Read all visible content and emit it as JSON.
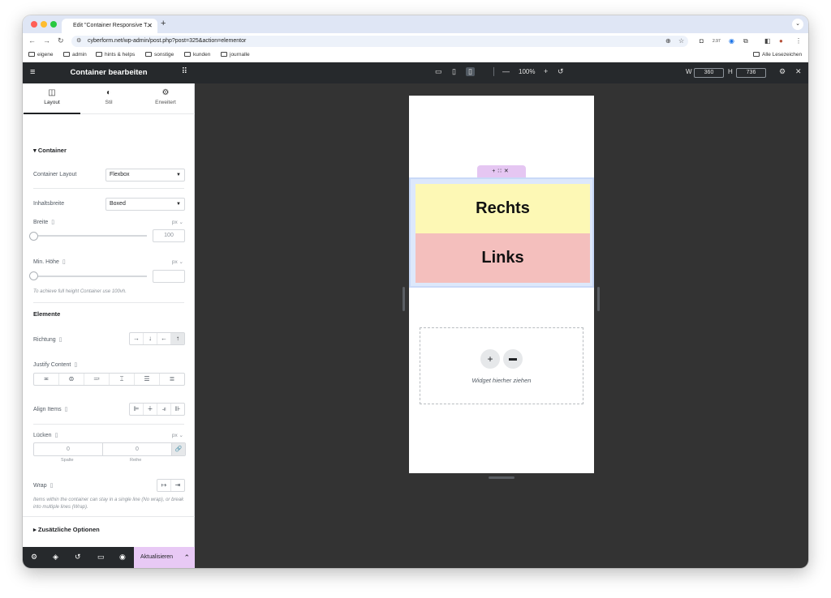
{
  "browser": {
    "tab_title": "Edit \"Container Responsive T...",
    "url": "cyberform.net/wp-admin/post.php?post=325&action=elementor",
    "bookmarks": [
      "eigene",
      "admin",
      "hints & helps",
      "sonstige",
      "kunden",
      "journalle"
    ],
    "all_bookmarks": "Alle Lesezeichen",
    "ext_badge": "2.97"
  },
  "panel": {
    "title": "Container bearbeiten",
    "tabs": [
      "Layout",
      "Stil",
      "Erweitert"
    ],
    "section_container": "Container",
    "container_layout_label": "Container Layout",
    "container_layout_value": "Flexbox",
    "content_width_label": "Inhaltsbreite",
    "content_width_value": "Boxed",
    "width_label": "Breite",
    "width_unit": "px",
    "width_value": "100",
    "min_height_label": "Min. Höhe",
    "min_height_unit": "px",
    "min_height_hint": "To achieve full height Container use 100vh.",
    "section_elements": "Elemente",
    "direction_label": "Richtung",
    "justify_label": "Justify Content",
    "align_label": "Align Items",
    "gaps_label": "Lücken",
    "gaps_unit": "px",
    "gap_column": "0",
    "gap_row": "0",
    "gap_column_label": "Spalte",
    "gap_row_label": "Reihe",
    "wrap_label": "Wrap",
    "wrap_hint": "Items within the container can stay in a single line (No wrap), or break into multiple lines (Wrap).",
    "additional_options": "Zusätzliche Optionen",
    "update_button": "Aktualisieren"
  },
  "topbar": {
    "zoom": "100%",
    "w_label": "W",
    "w_value": "360",
    "h_label": "H",
    "h_value": "736"
  },
  "canvas": {
    "box_top": "Rechts",
    "box_bottom": "Links",
    "drop_hint": "Widget hierher ziehen"
  },
  "colors": {
    "yellow_box": "#fdf8b5",
    "red_box": "#f4bfbd",
    "accent": "#e8c9f5"
  }
}
